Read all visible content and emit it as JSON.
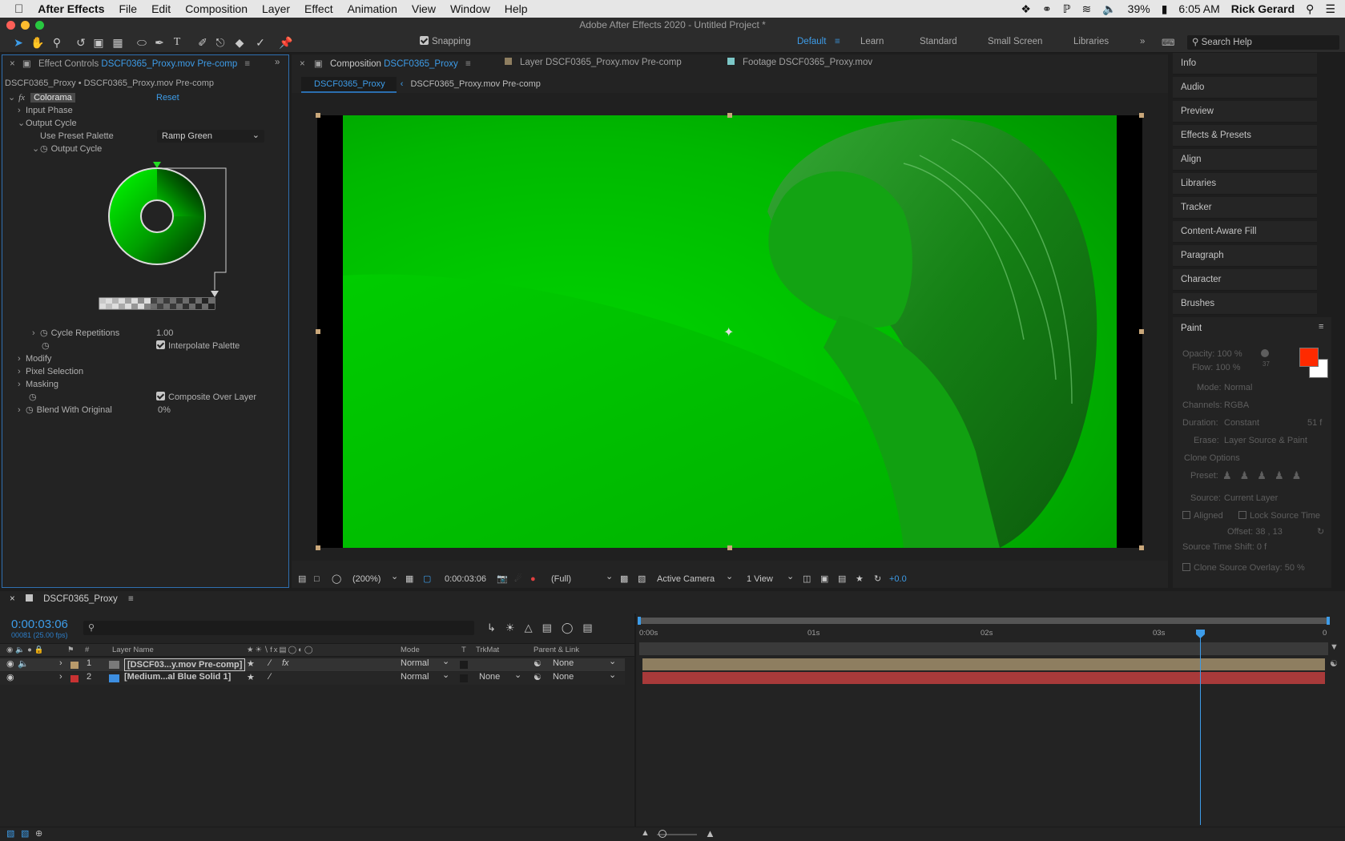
{
  "menubar": {
    "apple": "",
    "app": "After Effects",
    "items": [
      "File",
      "Edit",
      "Composition",
      "Layer",
      "Effect",
      "Animation",
      "View",
      "Window",
      "Help"
    ],
    "battery": "39%",
    "time": "6:05 AM",
    "user": "Rick Gerard"
  },
  "title": "Adobe After Effects 2020 - Untitled Project *",
  "toolbar": {
    "snapping": "Snapping",
    "workspaces": [
      "Default",
      "Learn",
      "Standard",
      "Small Screen",
      "Libraries"
    ],
    "search": "Search Help"
  },
  "effect_controls": {
    "tab_prefix": "Effect Controls",
    "tab_name": "DSCF0365_Proxy.mov Pre-comp",
    "breadcrumb": "DSCF0365_Proxy • DSCF0365_Proxy.mov Pre-comp",
    "fx_label": "fx",
    "effect_name": "Colorama",
    "reset": "Reset",
    "input_phase": "Input Phase",
    "output_cycle_group": "Output Cycle",
    "use_preset_label": "Use Preset Palette",
    "use_preset_value": "Ramp Green",
    "output_cycle": "Output Cycle",
    "cycle_reps_label": "Cycle Repetitions",
    "cycle_reps_value": "1.00",
    "interpolate": "Interpolate Palette",
    "modify": "Modify",
    "pixel_selection": "Pixel Selection",
    "masking": "Masking",
    "composite": "Composite Over Layer",
    "blend_label": "Blend With Original",
    "blend_value": "0%"
  },
  "composition": {
    "tab_prefix": "Composition",
    "tab_name": "DSCF0365_Proxy",
    "layer_tab": "Layer DSCF0365_Proxy.mov Pre-comp",
    "footage_tab": "Footage DSCF0365_Proxy.mov",
    "crumb1": "DSCF0365_Proxy",
    "crumb2": "DSCF0365_Proxy.mov Pre-comp",
    "zoom": "(200%)",
    "timecode": "0:00:03:06",
    "resolution": "(Full)",
    "camera": "Active Camera",
    "views": "1 View",
    "exposure": "+0.0"
  },
  "right_panels": [
    "Info",
    "Audio",
    "Preview",
    "Effects & Presets",
    "Align",
    "Libraries",
    "Tracker",
    "Content-Aware Fill",
    "Paragraph",
    "Character",
    "Brushes"
  ],
  "paint": {
    "title": "Paint",
    "opacity": "Opacity: 100 %",
    "flow": "Flow: 100 %",
    "brush_size": "37",
    "mode_label": "Mode:",
    "mode": "Normal",
    "channels_label": "Channels:",
    "channels": "RGBA",
    "duration_label": "Duration:",
    "duration": "Constant",
    "duration_frames": "51  f",
    "erase_label": "Erase:",
    "erase": "Layer Source & Paint",
    "clone_options": "Clone Options",
    "preset_label": "Preset:",
    "source_label": "Source:",
    "source": "Current Layer",
    "aligned": "Aligned",
    "lock_source": "Lock Source Time",
    "offset": "Offset: 38 ,          13",
    "shift": "Source Time Shift: 0  f",
    "overlay": "Clone Source Overlay:   50 %",
    "fg_color": "#ff2a00",
    "bg_color": "#ffffff"
  },
  "timeline": {
    "tab": "DSCF0365_Proxy",
    "timecode": "0:00:03:06",
    "frames": "00081 (25.00 fps)",
    "cols": {
      "num": "#",
      "name": "Layer Name",
      "mode": "Mode",
      "t": "T",
      "trkmat": "TrkMat",
      "parent": "Parent & Link"
    },
    "ruler": [
      "0:00s",
      "01s",
      "02s",
      "03s",
      "0"
    ],
    "layers": [
      {
        "num": "1",
        "name": "[DSCF03...y.mov Pre-comp]",
        "mode": "Normal",
        "trkmat": "",
        "parent": "None",
        "label": "#b89a6b",
        "bar": "#8e7e60"
      },
      {
        "num": "2",
        "name": "[Medium...al Blue Solid 1]",
        "mode": "Normal",
        "trkmat": "None",
        "parent": "None",
        "label": "#c83232",
        "bar": "#a83a3a"
      }
    ]
  }
}
